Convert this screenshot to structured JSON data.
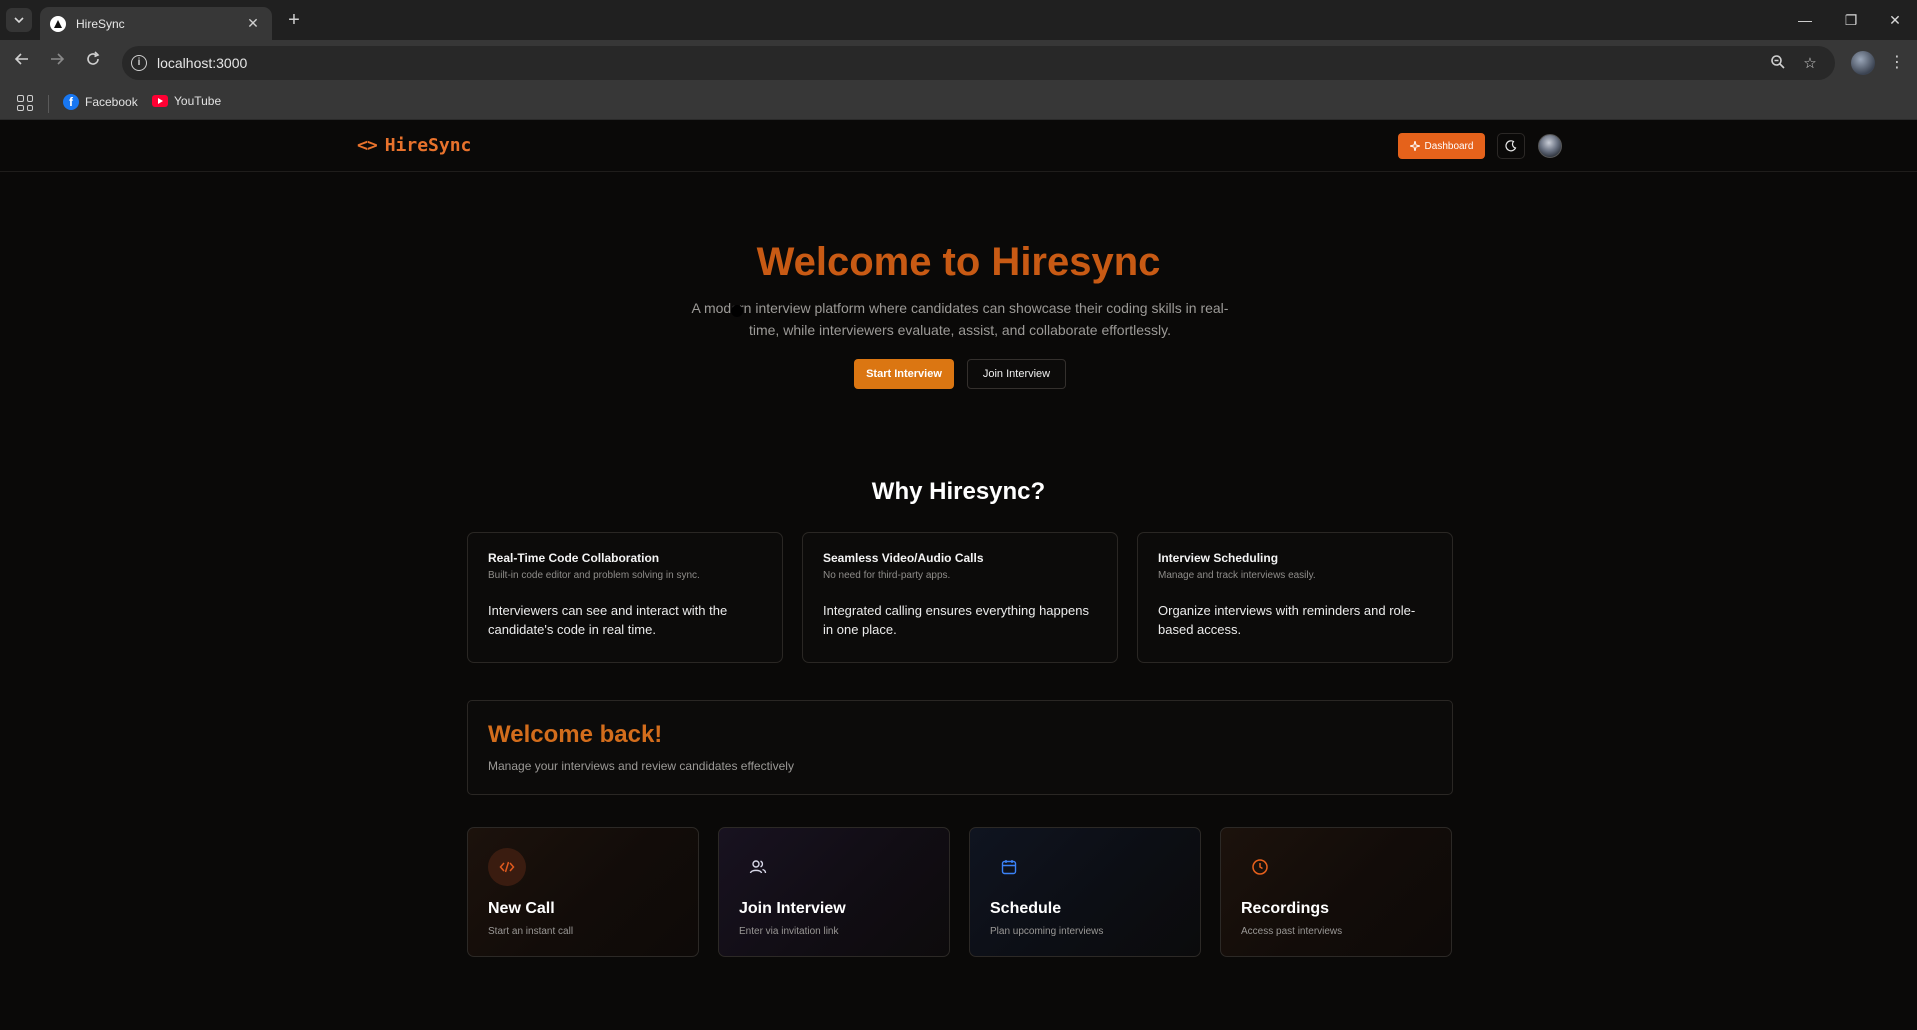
{
  "browser": {
    "tab_title": "HireSync",
    "url": "localhost:3000",
    "bookmarks": [
      {
        "label": "Facebook",
        "icon": "facebook-icon"
      },
      {
        "label": "YouTube",
        "icon": "youtube-icon"
      }
    ]
  },
  "navbar": {
    "brand": "HireSync",
    "brand_icon": "code-brackets-icon",
    "dashboard_label": "Dashboard",
    "dashboard_icon": "sparkle-icon",
    "theme_icon": "moon-icon"
  },
  "hero": {
    "title": "Welcome to Hiresync",
    "description": "A modern interview platform where candidates can showcase their coding skills in real-time, while interviewers evaluate, assist, and collaborate effortlessly.",
    "start_label": "Start Interview",
    "join_label": "Join Interview"
  },
  "why": {
    "title": "Why Hiresync?",
    "features": [
      {
        "title": "Real-Time Code Collaboration",
        "subtitle": "Built-in code editor and problem solving in sync.",
        "body": "Interviewers can see and interact with the candidate's code in real time."
      },
      {
        "title": "Seamless Video/Audio Calls",
        "subtitle": "No need for third-party apps.",
        "body": "Integrated calling ensures everything happens in one place."
      },
      {
        "title": "Interview Scheduling",
        "subtitle": "Manage and track interviews easily.",
        "body": "Organize interviews with reminders and role-based access."
      }
    ]
  },
  "welcome": {
    "title": "Welcome back!",
    "subtitle": "Manage your interviews and review candidates effectively"
  },
  "actions": [
    {
      "title": "New Call",
      "subtitle": "Start an instant call",
      "icon": "code-icon",
      "color": "#e05a1e"
    },
    {
      "title": "Join Interview",
      "subtitle": "Enter via invitation link",
      "icon": "users-icon",
      "color": "#d8d8e8"
    },
    {
      "title": "Schedule",
      "subtitle": "Plan upcoming interviews",
      "icon": "calendar-icon",
      "color": "#3b82f6"
    },
    {
      "title": "Recordings",
      "subtitle": "Access past interviews",
      "icon": "clock-icon",
      "color": "#e8611c"
    }
  ],
  "colors": {
    "accent": "#e5621b",
    "hero_title": "#c85a14",
    "background": "#0a0908"
  }
}
